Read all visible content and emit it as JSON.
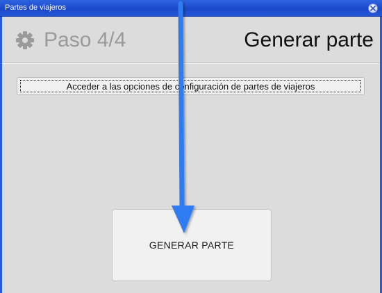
{
  "window": {
    "title": "Partes de viajeros"
  },
  "header": {
    "step_label": "Paso 4/4",
    "page_title": "Generar parte"
  },
  "config_button": {
    "label": "Acceder a las opciones de configuración de partes de viajeros"
  },
  "generate_button": {
    "label": "GENERAR PARTE"
  },
  "colors": {
    "titlebar": "#1f4fd0",
    "background": "#dcdcdc",
    "annotation_arrow": "#2d7bf0"
  }
}
